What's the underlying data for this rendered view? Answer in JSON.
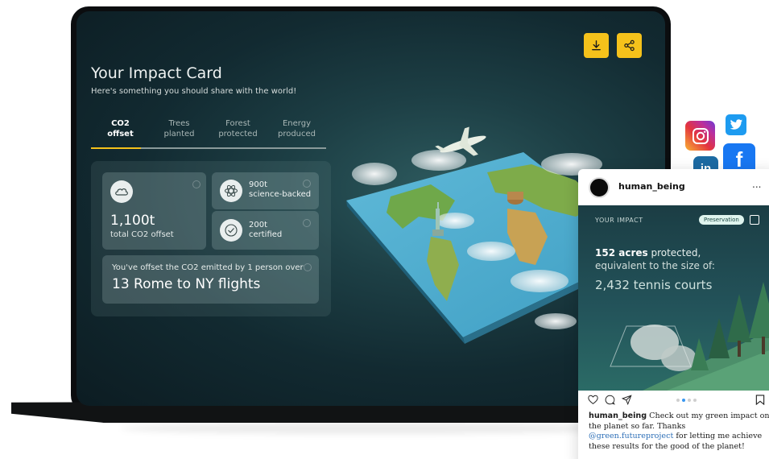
{
  "card": {
    "title": "Your Impact Card",
    "subtitle": "Here's something you should share with the world!",
    "actions": {
      "download_icon": "download-icon",
      "share_icon": "share-icon"
    }
  },
  "tabs": [
    {
      "line1": "CO2",
      "line2": "offset",
      "active": true
    },
    {
      "line1": "Trees",
      "line2": "planted",
      "active": false
    },
    {
      "line1": "Forest",
      "line2": "protected",
      "active": false
    },
    {
      "line1": "Energy",
      "line2": "produced",
      "active": false
    }
  ],
  "stats": {
    "total_value": "1,100t",
    "total_label": "total CO2 offset",
    "science_value": "900t",
    "science_label": "science-backed",
    "certified_value": "200t",
    "certified_label": "certified",
    "flights_desc": "You've offset the CO2 emitted by 1 person over",
    "flights_value": "13 Rome to NY flights"
  },
  "social_icons": [
    "instagram-icon",
    "twitter-icon",
    "facebook-icon",
    "linkedin-icon"
  ],
  "social_labels": {
    "facebook": "f",
    "linkedin": "in"
  },
  "post": {
    "username": "human_being",
    "more": "...",
    "image_label": "YOUR IMPACT",
    "badge": "Preservation",
    "line1_bold": "152 acres",
    "line1_rest": " protected,",
    "line2": "equivalent to the size of:",
    "line3": "2,432 tennis courts",
    "caption_user": "human_being",
    "caption_text1": " Check out my green impact on the planet so far. Thanks ",
    "caption_mention": "@green.futureproject",
    "caption_text2": " for letting me achieve these results for the good of the planet!"
  },
  "colors": {
    "accent": "#f5c21b",
    "screen_bg": "#163338",
    "mention": "#2d6fb7"
  }
}
